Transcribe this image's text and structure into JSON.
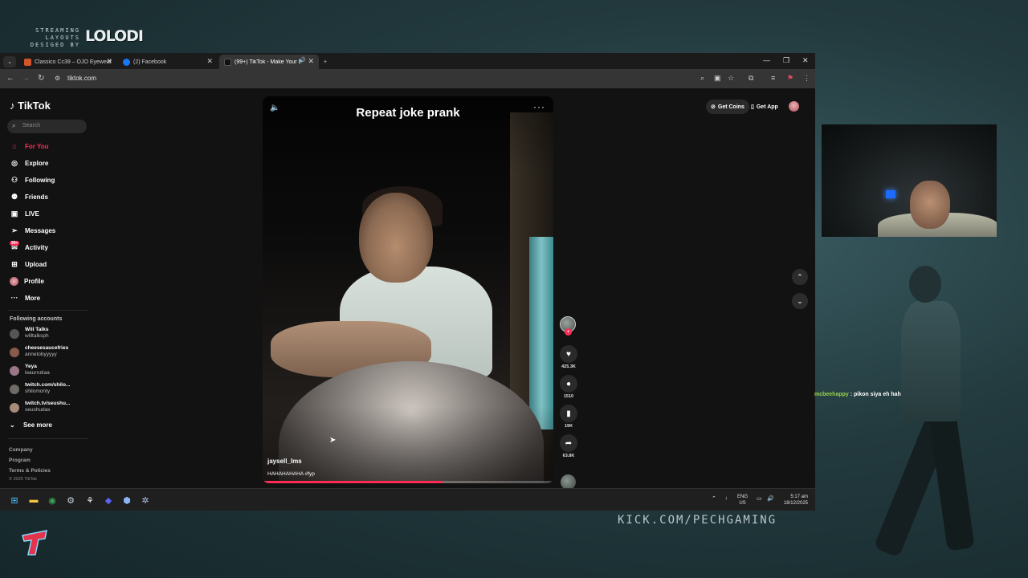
{
  "overlay": {
    "brand_small": "STREAMING LAYOUTS DESIGED BY",
    "brand_logo": "LOLODI",
    "kick_url": "KICK.COM/PECHGAMING",
    "chat_user": "mcbeehappy",
    "chat_text": ": pikon siya eh hahahah"
  },
  "browser": {
    "tabs": [
      {
        "title": "Classico Cc39 – OJO Eyewear",
        "favicon_color": "#d2552b"
      },
      {
        "title": "(2) Facebook",
        "favicon_color": "#1877f2"
      },
      {
        "title": "(99+) TikTok - Make Your Da...",
        "favicon_color": "#111111"
      }
    ],
    "new_tab": "+",
    "url": "tiktok.com"
  },
  "tiktok": {
    "logo": "TikTok",
    "search_placeholder": "Search",
    "nav": [
      {
        "label": "For You",
        "icon": "home-icon",
        "active": true
      },
      {
        "label": "Explore",
        "icon": "compass-icon"
      },
      {
        "label": "Following",
        "icon": "following-icon"
      },
      {
        "label": "Friends",
        "icon": "friends-icon"
      },
      {
        "label": "LIVE",
        "icon": "live-icon"
      },
      {
        "label": "Messages",
        "icon": "send-icon"
      },
      {
        "label": "Activity",
        "icon": "inbox-icon",
        "badge": "99+"
      },
      {
        "label": "Upload",
        "icon": "plus-square-icon"
      },
      {
        "label": "Profile",
        "icon": "avatar-icon"
      },
      {
        "label": "More",
        "icon": "more-icon"
      }
    ],
    "following_title": "Following accounts",
    "accounts": [
      {
        "name": "Will Talks",
        "handle": "willtalksph"
      },
      {
        "name": "cheesesaucefries",
        "handle": "annetobyyyyy"
      },
      {
        "name": "Yeya",
        "handle": "leaurrutiaa"
      },
      {
        "name": "twitch.com/shilo...",
        "handle": "shilomonty"
      },
      {
        "name": "twitch.tv/seushu...",
        "handle": "seushudas"
      }
    ],
    "see_more": "See more",
    "footer": [
      "Company",
      "Program",
      "Terms & Policies"
    ],
    "copyright": "© 2025 TikTok",
    "get_coins": "Get Coins",
    "get_app": "Get App",
    "video": {
      "title": "Repeat joke prank",
      "author": "jaysell_lms",
      "caption": "HAHAHAHAHA #fyp",
      "progress": 0.62
    },
    "stats": {
      "likes": "425.3K",
      "comments": "1510",
      "saves": "19K",
      "shares": "63.8K"
    }
  },
  "taskbar": {
    "lang_1": "ENG",
    "lang_2": "US",
    "time": "5:17 am",
    "date": "18/12/2025"
  }
}
